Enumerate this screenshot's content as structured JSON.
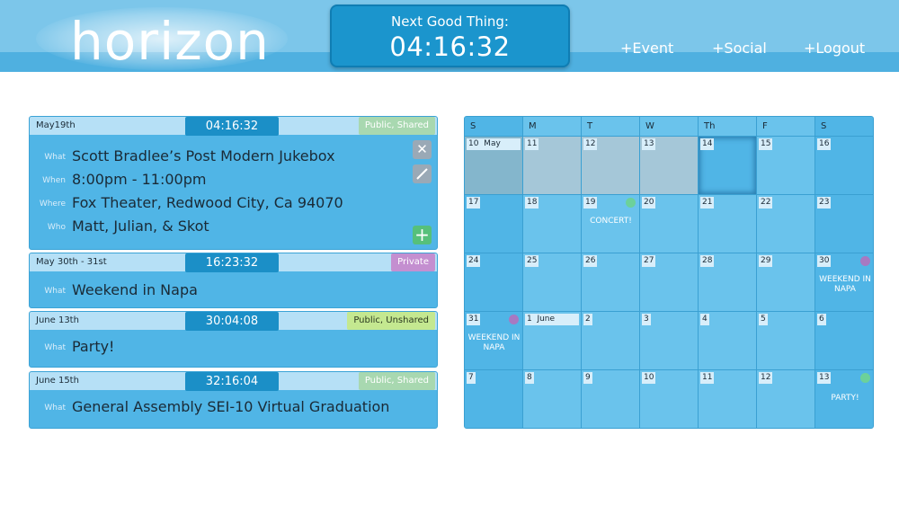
{
  "header": {
    "logo": "horizon",
    "countdown_label": "Next Good Thing:",
    "countdown_time": "04:16:32",
    "nav": [
      "+Event",
      "+Social",
      "+Logout"
    ]
  },
  "events": [
    {
      "date": "May19th",
      "timer": "04:16:32",
      "tag": "Public, Shared",
      "rows": [
        {
          "label": "What",
          "value": "Scott Bradlee’s Post Modern Jukebox"
        },
        {
          "label": "When",
          "value": "8:00pm - 11:00pm"
        },
        {
          "label": "Where",
          "value": "Fox Theater, Redwood City, Ca 94070"
        },
        {
          "label": "Who",
          "value": "Matt, Julian, & Skot"
        }
      ]
    },
    {
      "date": "May 30th - 31st",
      "timer": "16:23:32",
      "tag": "Private",
      "rows": [
        {
          "label": "What",
          "value": "Weekend in Napa"
        }
      ]
    },
    {
      "date": "June 13th",
      "timer": "30:04:08",
      "tag": "Public, Unshared",
      "rows": [
        {
          "label": "What",
          "value": "Party!"
        }
      ]
    },
    {
      "date": "June 15th",
      "timer": "32:16:04",
      "tag": "Public, Shared",
      "rows": [
        {
          "label": "What",
          "value": "General Assembly SEI-10 Virtual Graduation"
        }
      ]
    }
  ],
  "calendar": {
    "weekdays": [
      "S",
      "M",
      "T",
      "W",
      "Th",
      "F",
      "S"
    ],
    "weeks": [
      [
        "10  May",
        "11",
        "12",
        "13",
        "14",
        "15",
        "16"
      ],
      [
        "17",
        "18",
        "19",
        "20",
        "21",
        "22",
        "23"
      ],
      [
        "24",
        "25",
        "26",
        "27",
        "28",
        "29",
        "30"
      ],
      [
        "31",
        "1  June",
        "2",
        "3",
        "4",
        "5",
        "6"
      ],
      [
        "7",
        "8",
        "9",
        "10",
        "11",
        "12",
        "13"
      ]
    ],
    "events": {
      "concert": "CONCERT!",
      "napa_a": "WEEKEND IN NAPA",
      "napa_b": "WEEKEND IN NAPA",
      "party": "PARTY!"
    },
    "colors": {
      "green_dot": "#6cd19a",
      "purple_dot": "#a779c2"
    }
  }
}
